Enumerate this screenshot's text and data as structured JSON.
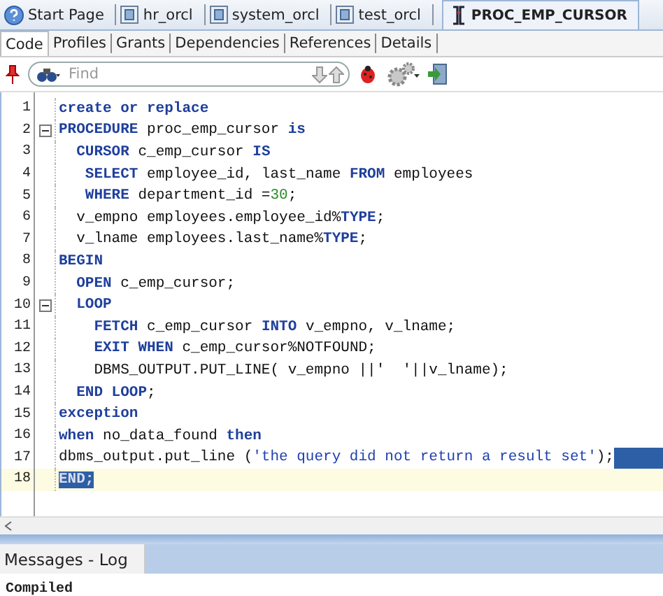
{
  "editor_tabs": [
    {
      "label": "Start Page",
      "kind": "help",
      "selected": false
    },
    {
      "label": "hr_orcl",
      "kind": "connection",
      "selected": false
    },
    {
      "label": "system_orcl",
      "kind": "connection",
      "selected": false
    },
    {
      "label": "test_orcl",
      "kind": "connection",
      "selected": false
    },
    {
      "label": "PROC_EMP_CURSOR",
      "kind": "procedure",
      "selected": true
    }
  ],
  "view_tabs": [
    {
      "label": "Code",
      "selected": true
    },
    {
      "label": "Profiles",
      "selected": false
    },
    {
      "label": "Grants",
      "selected": false
    },
    {
      "label": "Dependencies",
      "selected": false
    },
    {
      "label": "References",
      "selected": false
    },
    {
      "label": "Details",
      "selected": false
    }
  ],
  "toolbar": {
    "search": {
      "placeholder": "Find"
    }
  },
  "code_lines": [
    {
      "number": "1",
      "foldable": false,
      "current": false,
      "selected_to_end": false,
      "tokens": [
        {
          "kind": "keyword",
          "text": "create or replace"
        }
      ]
    },
    {
      "number": "2",
      "foldable": true,
      "current": false,
      "selected_to_end": false,
      "tokens": [
        {
          "kind": "keyword",
          "text": "PROCEDURE"
        },
        {
          "kind": "plain",
          "text": " proc_emp_cursor "
        },
        {
          "kind": "keyword",
          "text": "is"
        }
      ]
    },
    {
      "number": "3",
      "foldable": false,
      "current": false,
      "selected_to_end": false,
      "tokens": [
        {
          "kind": "keyword",
          "text": "  CURSOR"
        },
        {
          "kind": "plain",
          "text": " c_emp_cursor "
        },
        {
          "kind": "keyword",
          "text": "IS"
        }
      ]
    },
    {
      "number": "4",
      "foldable": false,
      "current": false,
      "selected_to_end": false,
      "tokens": [
        {
          "kind": "keyword",
          "text": "   SELECT"
        },
        {
          "kind": "plain",
          "text": " employee_id, last_name "
        },
        {
          "kind": "keyword",
          "text": "FROM"
        },
        {
          "kind": "plain",
          "text": " employees"
        }
      ]
    },
    {
      "number": "5",
      "foldable": false,
      "current": false,
      "selected_to_end": false,
      "tokens": [
        {
          "kind": "keyword",
          "text": "   WHERE"
        },
        {
          "kind": "plain",
          "text": " department_id ="
        },
        {
          "kind": "number",
          "text": "30"
        },
        {
          "kind": "plain",
          "text": ";"
        }
      ]
    },
    {
      "number": "6",
      "foldable": false,
      "current": false,
      "selected_to_end": false,
      "tokens": [
        {
          "kind": "plain",
          "text": "  v_empno employees.employee_id%"
        },
        {
          "kind": "keyword",
          "text": "TYPE"
        },
        {
          "kind": "plain",
          "text": ";"
        }
      ]
    },
    {
      "number": "7",
      "foldable": false,
      "current": false,
      "selected_to_end": false,
      "tokens": [
        {
          "kind": "plain",
          "text": "  v_lname employees.last_name%"
        },
        {
          "kind": "keyword",
          "text": "TYPE"
        },
        {
          "kind": "plain",
          "text": ";"
        }
      ]
    },
    {
      "number": "8",
      "foldable": false,
      "current": false,
      "selected_to_end": false,
      "tokens": [
        {
          "kind": "keyword",
          "text": "BEGIN"
        }
      ]
    },
    {
      "number": "9",
      "foldable": false,
      "current": false,
      "selected_to_end": false,
      "tokens": [
        {
          "kind": "keyword",
          "text": "  OPEN"
        },
        {
          "kind": "plain",
          "text": " c_emp_cursor;"
        }
      ]
    },
    {
      "number": "10",
      "foldable": true,
      "current": false,
      "selected_to_end": false,
      "tokens": [
        {
          "kind": "keyword",
          "text": "  LOOP"
        }
      ]
    },
    {
      "number": "11",
      "foldable": false,
      "current": false,
      "selected_to_end": false,
      "tokens": [
        {
          "kind": "keyword",
          "text": "    FETCH"
        },
        {
          "kind": "plain",
          "text": " c_emp_cursor "
        },
        {
          "kind": "keyword",
          "text": "INTO"
        },
        {
          "kind": "plain",
          "text": " v_empno, v_lname;"
        }
      ]
    },
    {
      "number": "12",
      "foldable": false,
      "current": false,
      "selected_to_end": false,
      "tokens": [
        {
          "kind": "keyword",
          "text": "    EXIT WHEN"
        },
        {
          "kind": "plain",
          "text": " c_emp_cursor%NOTFOUND;"
        }
      ]
    },
    {
      "number": "13",
      "foldable": false,
      "current": false,
      "selected_to_end": false,
      "tokens": [
        {
          "kind": "plain",
          "text": "    DBMS_OUTPUT.PUT_LINE( v_empno ||'  '||v_lname);"
        }
      ]
    },
    {
      "number": "14",
      "foldable": false,
      "current": false,
      "selected_to_end": false,
      "tokens": [
        {
          "kind": "keyword",
          "text": "  END LOOP"
        },
        {
          "kind": "plain",
          "text": ";"
        }
      ]
    },
    {
      "number": "15",
      "foldable": false,
      "current": false,
      "selected_to_end": false,
      "tokens": [
        {
          "kind": "keyword",
          "text": "exception"
        }
      ]
    },
    {
      "number": "16",
      "foldable": false,
      "current": false,
      "selected_to_end": false,
      "tokens": [
        {
          "kind": "keyword",
          "text": "when"
        },
        {
          "kind": "plain",
          "text": " no_data_found "
        },
        {
          "kind": "keyword",
          "text": "then"
        }
      ]
    },
    {
      "number": "17",
      "foldable": false,
      "current": false,
      "selected_to_end": true,
      "tokens": [
        {
          "kind": "plain",
          "text": "dbms_output.put_line ("
        },
        {
          "kind": "string",
          "text": "'the query did not return a result set'"
        },
        {
          "kind": "plain",
          "text": ");"
        }
      ]
    },
    {
      "number": "18",
      "foldable": false,
      "current": true,
      "selected_to_end": false,
      "tokens": [
        {
          "kind": "selected",
          "text": "END;"
        }
      ]
    }
  ],
  "messages": {
    "tab": {
      "label": "Messages - Log",
      "selected": true
    },
    "lines": [
      "Compiled"
    ]
  }
}
